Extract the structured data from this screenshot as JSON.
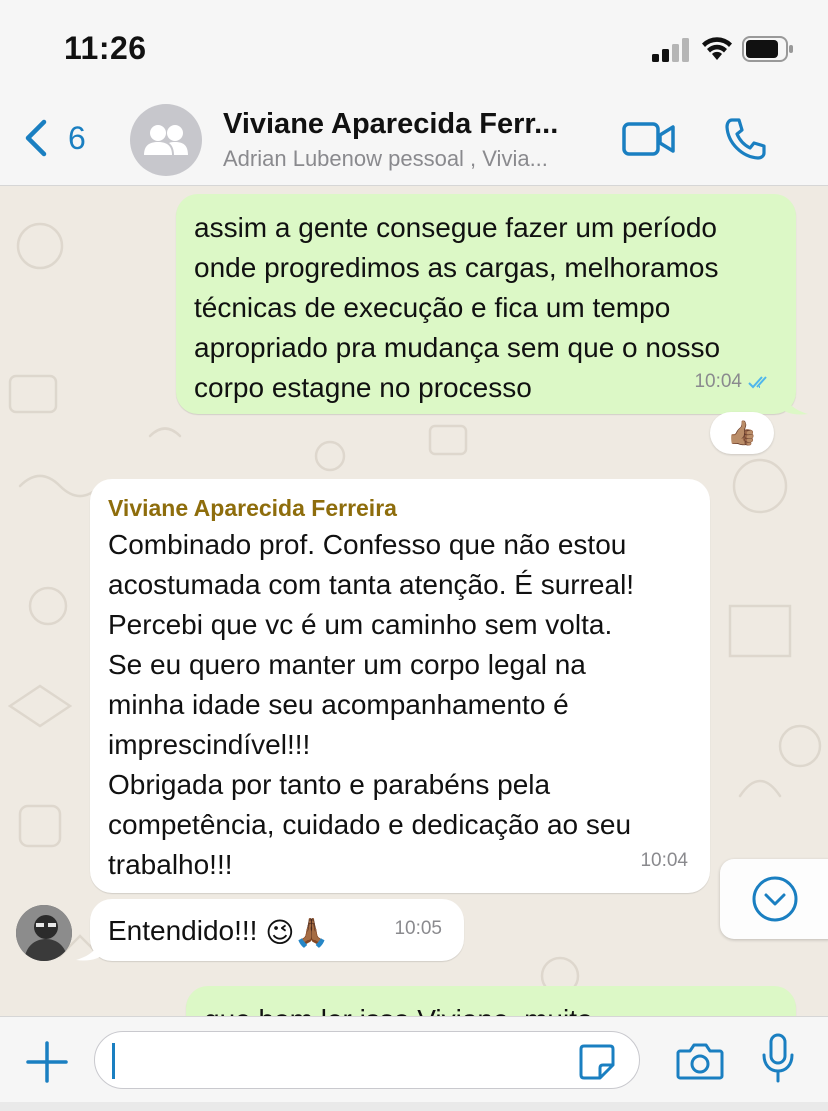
{
  "status_bar": {
    "time": "11:26"
  },
  "header": {
    "back_count": "6",
    "title": "Viviane Aparecida Ferr...",
    "subtitle": "Adrian Lubenow pessoal , Vivia..."
  },
  "messages": [
    {
      "direction": "outgoing",
      "text": "assim a gente consegue fazer um período onde progredimos as cargas, melhoramos técnicas de execução e fica um tempo apropriado pra mudança sem que o nosso corpo estagne no processo",
      "time": "10:04",
      "reaction": "👍🏽"
    },
    {
      "direction": "incoming",
      "sender": "Viviane Aparecida Ferreira",
      "lines": [
        "Combinado prof. Confesso que não estou",
        "acostumada com tanta atenção. É surreal!",
        "Percebi que vc é um caminho sem volta.",
        "Se eu quero manter um corpo legal na",
        "minha idade seu acompanhamento é",
        "imprescindível!!!",
        "Obrigada por tanto e parabéns pela",
        "competência, cuidado e dedicação ao seu",
        "trabalho!!!"
      ],
      "time": "10:04"
    },
    {
      "direction": "incoming",
      "text": "Entendido!!!",
      "emojis": "😉🙏🏾",
      "time": "10:05"
    },
    {
      "direction": "outgoing",
      "text": "que bom ler isso Viviane, muito"
    }
  ],
  "input": {
    "placeholder": ""
  },
  "colors": {
    "accent": "#1a7fc1",
    "outgoing_bubble": "#dcf8c6",
    "incoming_bubble": "#ffffff",
    "sender_name": "#8e6d0c",
    "read_ticks": "#4fb6ec"
  },
  "icons": [
    "back-chevron-icon",
    "group-avatar-icon",
    "video-call-icon",
    "phone-icon",
    "read-ticks-icon",
    "scroll-down-icon",
    "plus-icon",
    "sticker-icon",
    "camera-icon",
    "microphone-icon"
  ]
}
